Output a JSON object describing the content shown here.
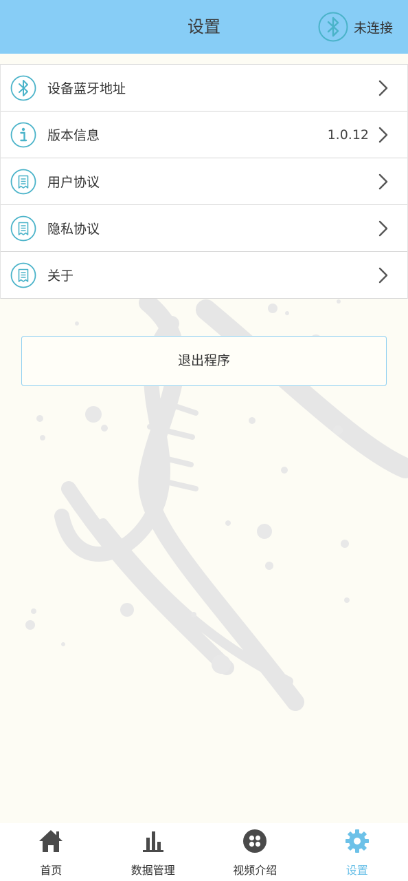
{
  "header": {
    "title": "设置",
    "bluetooth_status": "未连接"
  },
  "settings": {
    "items": [
      {
        "label": "设备蓝牙地址",
        "value": "",
        "icon": "bluetooth-icon"
      },
      {
        "label": "版本信息",
        "value": "1.0.12",
        "icon": "info-icon"
      },
      {
        "label": "用户协议",
        "value": "",
        "icon": "document-icon"
      },
      {
        "label": "隐私协议",
        "value": "",
        "icon": "document-icon"
      },
      {
        "label": "关于",
        "value": "",
        "icon": "document-icon"
      }
    ]
  },
  "exit_button": {
    "label": "退出程序"
  },
  "tabbar": {
    "tabs": [
      {
        "label": "首页",
        "icon": "home-icon",
        "active": false
      },
      {
        "label": "数据管理",
        "icon": "bar-chart-icon",
        "active": false
      },
      {
        "label": "视频介绍",
        "icon": "video-dots-icon",
        "active": false
      },
      {
        "label": "设置",
        "icon": "gear-icon",
        "active": true
      }
    ]
  },
  "colors": {
    "header_bg": "#87cdf6",
    "accent": "#4ab3c9",
    "active_tab": "#6cc1e8",
    "page_bg": "#fdfcf4"
  }
}
